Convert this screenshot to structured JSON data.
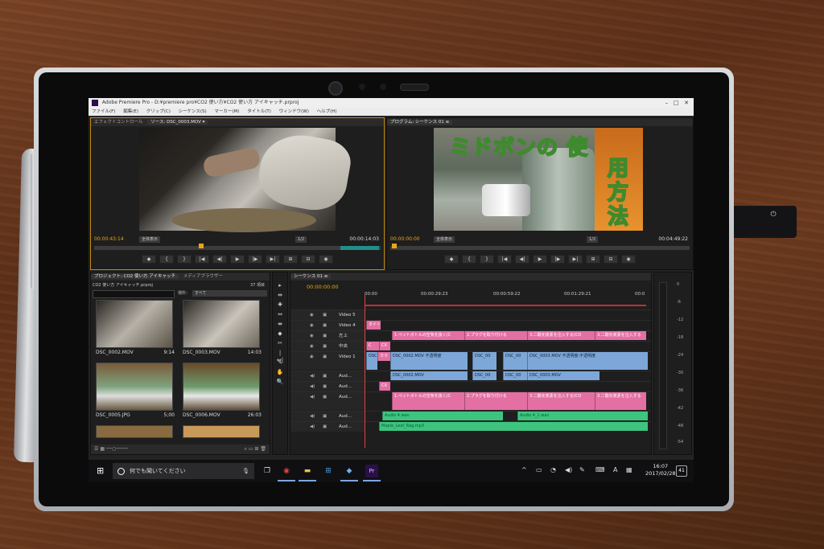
{
  "window": {
    "title": "Adobe Premiere Pro - D:¥premiere pro¥CO2 使い方¥CO2 使い方 アイキャッチ.prproj",
    "controls": [
      "–",
      "□",
      "✕"
    ]
  },
  "menu": [
    "ファイル(F)",
    "編集(E)",
    "クリップ(C)",
    "シーケンス(S)",
    "マーカー(M)",
    "タイトル(T)",
    "ウィンドウ(W)",
    "ヘルプ(H)"
  ],
  "source_panel": {
    "tabs": [
      "エフェクトコントロール",
      "ソース: DSC_0003.MOV ▾"
    ],
    "timecode": "00:00:43:14",
    "duration": "00:00:14:03",
    "fit": "全体表示",
    "resolution": "1/2"
  },
  "program_panel": {
    "tab": "プログラム: シーケンス 01 ≡",
    "timecode": "00:00:00:00",
    "duration": "00:04:49:22",
    "fit": "全体表示",
    "resolution": "1/2",
    "caption_line1": "ミドボンの 使",
    "caption_line2": "用方法"
  },
  "transport_buttons": [
    "◆",
    "{",
    "}",
    "|◀",
    "◀|",
    "▶",
    "|▶",
    "▶|",
    "⊞",
    "⊟",
    "◉"
  ],
  "project_panel": {
    "tabs": [
      "プロジェクト: CO2 使い方 アイキャッチ",
      "メディアブラウザー"
    ],
    "file": "CO2 使い方 アイキャッチ.prproj",
    "count": "37 項目",
    "location_label": "場所：",
    "location_value": "すべて",
    "items": [
      {
        "name": "DSC_0002.MOV",
        "duration": "9:14"
      },
      {
        "name": "DSC_0003.MOV",
        "duration": "14:03"
      },
      {
        "name": "DSC_0005.JPG",
        "duration": "5;00"
      },
      {
        "name": "DSC_0006.MOV",
        "duration": "26:03"
      }
    ]
  },
  "tools": [
    "▸",
    "⇹",
    "✚",
    "⇔",
    "⇼",
    "◆",
    "✂",
    "|↔|",
    "✎",
    "✋",
    "🔍"
  ],
  "timeline": {
    "tab": "シーケンス 01 ≡",
    "timecode": "00:00:00:00",
    "ruler": [
      "00:00",
      "00:00:29:23",
      "00:00:59:22",
      "00:01:29:21",
      "00:0"
    ],
    "tracks": [
      {
        "name": "Video 5",
        "clips": []
      },
      {
        "name": "Video 4",
        "clips": [
          "タイト"
        ]
      },
      {
        "name": "左上",
        "clips": [
          "1.ペットボトルの空気を抜く(C",
          "2.プラグを取り付ける",
          "3.二酸化炭素を注入する(CO",
          "3.二酸化炭素を注入する"
        ]
      },
      {
        "name": "中央",
        "clips": [
          "C",
          "CX"
        ]
      },
      {
        "name": "Video 1",
        "clips": [
          "DSC",
          "カラ",
          "DSC_0002.MOV 不透明度",
          "DSC_00",
          "DSC_00",
          "DSC_0003.MOV 不透明度:不透明度"
        ]
      },
      {
        "name": "Aud...",
        "clips": [
          "DSC_0002.MOV",
          "DSC_00",
          "DSC_00",
          "DSC_0003.MOV"
        ]
      },
      {
        "name": "Aud...",
        "clips": [
          "CX"
        ]
      },
      {
        "name": "Aud...",
        "clips": [
          "1.ペットボトルの空気を抜く(C",
          "2.プラグを取り付ける",
          "3.二酸化炭素を注入する(CO",
          "3.二酸化炭素を注入する"
        ]
      },
      {
        "name": "Aud...",
        "clips": [
          "Audio 4.wav",
          "Audio 4_1.wav"
        ]
      },
      {
        "name": "Aud...",
        "clips": [
          "Maple_Leaf_Rag.mp3"
        ]
      }
    ],
    "side_labels": [
      "V",
      "A1"
    ]
  },
  "meter_ticks": [
    "0",
    "-6",
    "-12",
    "-18",
    "-24",
    "-30",
    "-36",
    "-42",
    "-48",
    "-54"
  ],
  "taskbar": {
    "search_placeholder": "何でも聞いてください",
    "time": "16:07",
    "date": "2017/02/28",
    "ime": "A",
    "notifications": "41"
  }
}
